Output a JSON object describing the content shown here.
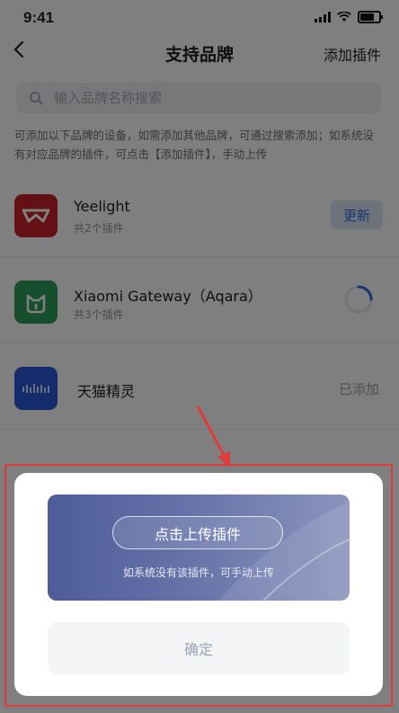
{
  "status_bar": {
    "time": "9:41",
    "battery_level": 0.85
  },
  "nav": {
    "back_icon": "chevron-left-icon",
    "title": "支持品牌",
    "action_label": "添加插件"
  },
  "search": {
    "placeholder": "输入品牌名称搜索"
  },
  "description": "可添加以下品牌的设备，如需添加其他品牌，可通过搜索添加；如系统没有对应品牌的插件，可点击【添加插件】，手动上传",
  "brands": [
    {
      "name": "Yeelight",
      "subtitle": "共2个插件",
      "action_label": "更新",
      "logo_color": "#c8232c"
    },
    {
      "name": "Xiaomi Gateway（Aqara）",
      "subtitle": "共3个插件",
      "state": "loading",
      "logo_color": "#2f9c5c"
    },
    {
      "name": "天猫精灵",
      "action_label": "已添加",
      "logo_color": "#2958d8"
    }
  ],
  "dialog": {
    "upload_label": "点击上传插件",
    "hint": "如系统没有该插件，可手动上传",
    "confirm_label": "确定"
  },
  "colors": {
    "accent": "#2c6ce0",
    "annotation": "#e13a3a",
    "banner": "#5f6ba3"
  }
}
